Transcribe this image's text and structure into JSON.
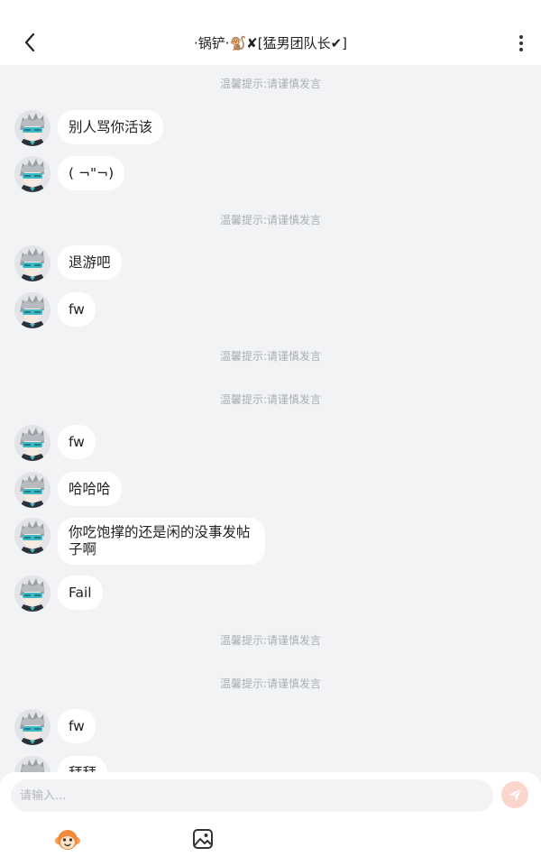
{
  "header": {
    "title": "·锅铲·🐒✘[猛男团队长✔]",
    "back_icon": "chevron-left-icon",
    "more_icon": "vertical-dots-icon"
  },
  "chat": {
    "notice_text": "温馨提示:请谨慎发言",
    "messages": [
      {
        "text": "别人骂你活该"
      },
      {
        "text": "( ¬\"¬)"
      },
      {
        "text": "退游吧"
      },
      {
        "text": "fw"
      },
      {
        "text": "fw"
      },
      {
        "text": "哈哈哈"
      },
      {
        "text": "你吃饱撑的还是闲的没事发帖子啊"
      },
      {
        "text": "Fail"
      },
      {
        "text": "fw"
      },
      {
        "text": "拜拜"
      }
    ]
  },
  "footer": {
    "input_placeholder": "请输入...",
    "send_icon": "paper-plane-icon",
    "emoji_icon": "monkey-emoji-icon",
    "image_icon": "image-icon"
  },
  "colors": {
    "background": "#f2f3f5",
    "bubble": "#ffffff",
    "notice": "#a9adb3",
    "send_button": "#fbd6cd",
    "send_arrow": "#ffffff"
  }
}
